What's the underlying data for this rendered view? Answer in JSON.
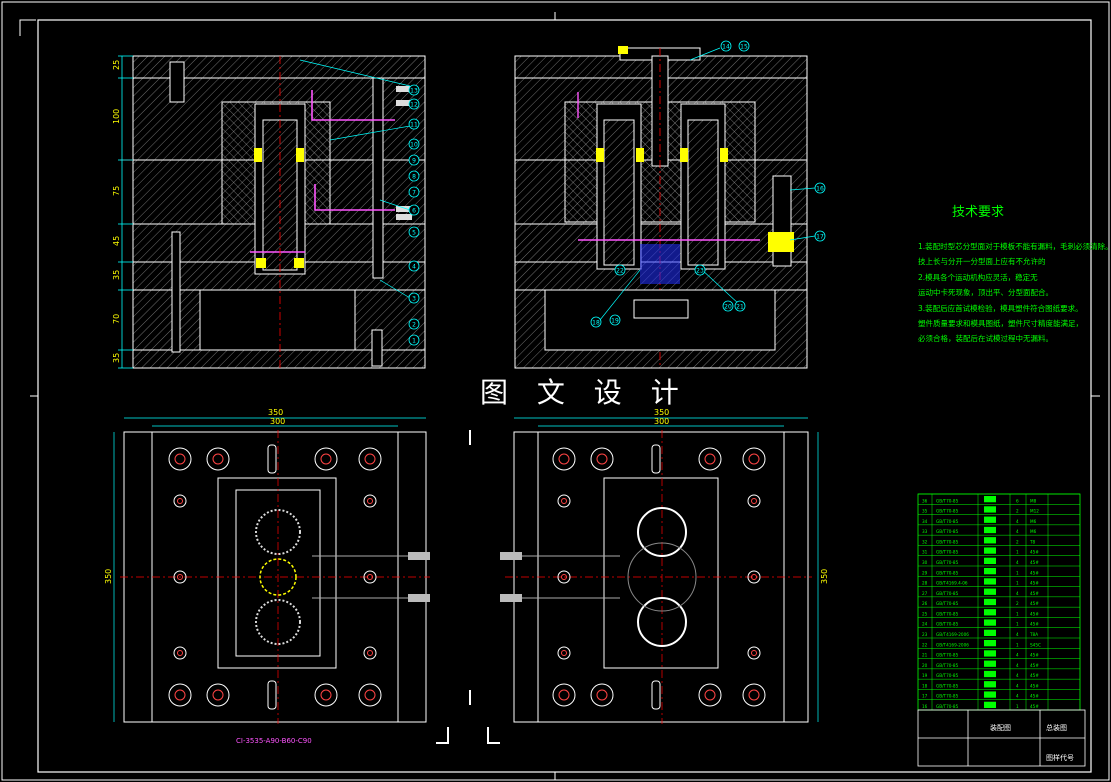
{
  "watermark": "图 文 设 计",
  "technical_requirements": {
    "heading": "技术要求",
    "lines": [
      "1.装配时型芯分型面对于模板不能有漏料，毛刺必须清除。",
      "技上长与分开一分型面上应有不允许的",
      "2.模具各个运动机构应灵活，稳定无",
      "运动中卡死现象，顶出平、分型面配合。",
      "3.装配后应首试模检验，模具塑件符合图纸要求。",
      "塑件质量要求和模具图纸，塑件尺寸精度能满足，",
      "必须合格，装配后在试模过程中无漏料。"
    ]
  },
  "top_left_view": {
    "dims_vertical": [
      "25",
      "100",
      "75",
      "45",
      "35",
      "70",
      "35"
    ],
    "balloons": [
      "13",
      "12",
      "11",
      "10",
      "9",
      "8",
      "7",
      "6",
      "5",
      "4",
      "3",
      "2",
      "1"
    ]
  },
  "top_right_view": {
    "balloons": [
      "14",
      "15",
      "16",
      "17",
      "18",
      "19",
      "20",
      "21",
      "22",
      "23"
    ]
  },
  "bottom_left_view": {
    "dims": {
      "overall_width": "350",
      "inner_width": "300",
      "height": "350"
    },
    "part_code": "CI-3535-A90-B60-C90"
  },
  "bottom_right_view": {
    "dims": {
      "overall_width": "350",
      "inner_width": "300",
      "height": "350"
    }
  },
  "parts_list": {
    "rows": [
      [
        "36",
        "GB/T70-85",
        "6",
        "M8"
      ],
      [
        "35",
        "GB/T70-85",
        "2",
        "M12"
      ],
      [
        "34",
        "GB/T70-85",
        "4",
        "M6"
      ],
      [
        "33",
        "GB/T70-85",
        "4",
        "M6"
      ],
      [
        "32",
        "GB/T70-85",
        "2",
        "T8"
      ],
      [
        "31",
        "GB/T70-85",
        "1",
        "45#"
      ],
      [
        "30",
        "GB/T70-85",
        "4",
        "45#"
      ],
      [
        "29",
        "GB/T70-85",
        "1",
        "45#"
      ],
      [
        "28",
        "GB/T4169.4-06",
        "1",
        "45#"
      ],
      [
        "27",
        "GB/T70-85",
        "4",
        "45#"
      ],
      [
        "26",
        "GB/T70-85",
        "2",
        "45#"
      ],
      [
        "25",
        "GB/T70-85",
        "1",
        "45#"
      ],
      [
        "24",
        "GB/T70-85",
        "1",
        "45#"
      ],
      [
        "23",
        "GB/T4169-2006",
        "4",
        "T8A"
      ],
      [
        "22",
        "GB/T4169-2006",
        "1",
        "S45C"
      ],
      [
        "21",
        "GB/T70-85",
        "4",
        "45#"
      ],
      [
        "20",
        "GB/T70-85",
        "4",
        "45#"
      ],
      [
        "19",
        "GB/T70-85",
        "4",
        "45#"
      ],
      [
        "18",
        "GB/T70-85",
        "4",
        "45#"
      ],
      [
        "17",
        "GB/T70-85",
        "4",
        "45#"
      ],
      [
        "16",
        "GB/T70-85",
        "1",
        "45#"
      ]
    ],
    "title_block": {
      "title": "装配图",
      "label_assembly": "总装图",
      "label_code": "图样代号"
    }
  }
}
